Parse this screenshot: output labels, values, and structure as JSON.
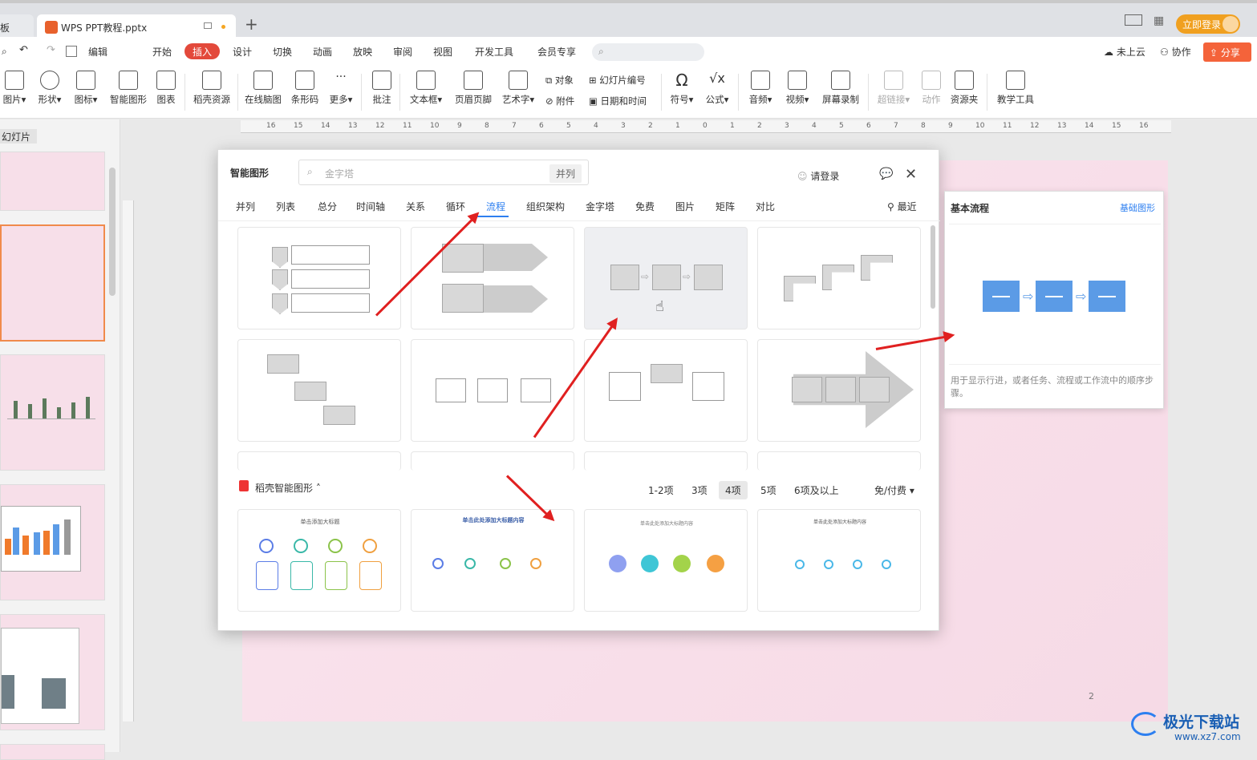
{
  "window": {
    "prev_tab_fragment": "板",
    "tab_title": "WPS PPT教程.pptx",
    "login_button": "立即登录"
  },
  "menu": {
    "items": [
      "编辑",
      "开始",
      "插入",
      "设计",
      "切换",
      "动画",
      "放映",
      "审阅",
      "视图",
      "开发工具",
      "会员专享"
    ],
    "active": "插入",
    "right": {
      "cloud": "未上云",
      "collab": "协作",
      "share": "分享"
    }
  },
  "toolbar": {
    "tools": [
      "图片",
      "形状",
      "图标",
      "智能图形",
      "图表",
      "稻壳资源",
      "在线脑图",
      "条形码",
      "更多",
      "批注",
      "文本框",
      "页眉页脚",
      "艺术字",
      "符号",
      "公式",
      "音频",
      "视频",
      "屏幕录制",
      "超链接",
      "动作",
      "资源夹",
      "教学工具"
    ],
    "small": [
      "对象",
      "幻灯片编号",
      "附件",
      "日期和时间"
    ]
  },
  "left_panel": {
    "header": "幻灯片"
  },
  "ruler": {
    "top_labels": [
      "16",
      "15",
      "14",
      "13",
      "12",
      "11",
      "10",
      "9",
      "8",
      "7",
      "6",
      "5",
      "4",
      "3",
      "2",
      "1",
      "0",
      "1",
      "2",
      "3",
      "4",
      "5",
      "6",
      "7",
      "8",
      "9",
      "10",
      "11",
      "12",
      "13",
      "14",
      "15",
      "16"
    ]
  },
  "slide": {
    "page_number": "2"
  },
  "dialog": {
    "title": "智能图形",
    "search_placeholder": "金字塔",
    "search_tag": "并列",
    "login": "请登录",
    "categories": [
      "并列",
      "列表",
      "总分",
      "时间轴",
      "关系",
      "循环",
      "流程",
      "组织架构",
      "金字塔",
      "免费",
      "图片",
      "矩阵",
      "对比"
    ],
    "active_category": "流程",
    "recent": "最近",
    "section_title": "稻壳智能图形",
    "filters": [
      "1-2项",
      "3项",
      "4项",
      "5项",
      "6项及以上"
    ],
    "active_filter": "4项",
    "pay_filter": "免/付费",
    "template_titles": [
      "单击添加大标题",
      "单击此处添加大标题内容",
      "单击此处添加大标题内容",
      "单击此处添加大标题内容"
    ]
  },
  "preview": {
    "title": "基本流程",
    "link": "基础图形",
    "description": "用于显示行进，或者任务、流程或工作流中的顺序步骤。"
  },
  "watermark": {
    "text": "极光下载站",
    "url": "www.xz7.com"
  }
}
